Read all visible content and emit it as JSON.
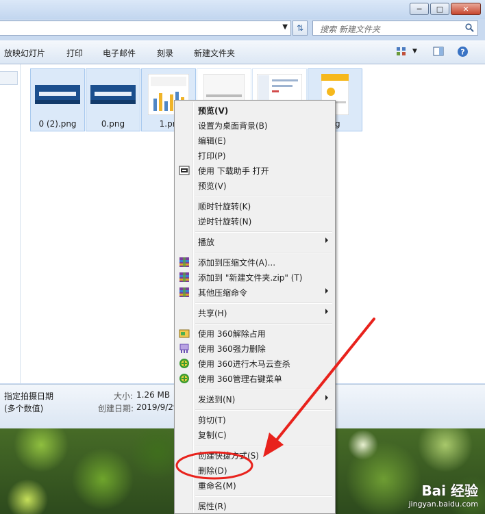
{
  "search": {
    "placeholder": "搜索 新建文件夹"
  },
  "toolbar": {
    "items": [
      "放映幻灯片",
      "打印",
      "电子邮件",
      "刻录",
      "新建文件夹"
    ]
  },
  "files": [
    {
      "name": "0 (2).png"
    },
    {
      "name": "0.png"
    },
    {
      "name": "1.pn"
    },
    {
      "name": ""
    },
    {
      "name": ""
    },
    {
      "name": "ng"
    }
  ],
  "details": {
    "left1": "指定拍摄日期",
    "left2": "(多个数值)",
    "size_label": "大小:",
    "size_value": "1.26 MB",
    "created_label": "创建日期:",
    "created_value": "2019/9/29"
  },
  "context_menu": {
    "items": [
      {
        "label": "预览(V)",
        "bold": true
      },
      {
        "label": "设置为桌面背景(B)"
      },
      {
        "label": "编辑(E)"
      },
      {
        "label": "打印(P)"
      },
      {
        "label": "使用 下载助手 打开",
        "icon": "download-helper-icon"
      },
      {
        "label": "预览(V)"
      },
      {
        "label": "顺时针旋转(K)"
      },
      {
        "label": "逆时针旋转(N)"
      },
      {
        "label": "播放",
        "submenu": true
      },
      {
        "label": "添加到压缩文件(A)...",
        "icon": "winrar-icon"
      },
      {
        "label": "添加到 \"新建文件夹.zip\" (T)",
        "icon": "winrar-icon"
      },
      {
        "label": "其他压缩命令",
        "icon": "winrar-icon",
        "submenu": true
      },
      {
        "label": "共享(H)",
        "submenu": true
      },
      {
        "label": "使用 360解除占用",
        "icon": "unlock-360-icon"
      },
      {
        "label": "使用 360强力删除",
        "icon": "shred-360-icon"
      },
      {
        "label": "使用 360进行木马云查杀",
        "icon": "shield-360-icon"
      },
      {
        "label": "使用 360管理右键菜单",
        "icon": "shield-360-icon"
      },
      {
        "label": "发送到(N)",
        "submenu": true
      },
      {
        "label": "剪切(T)"
      },
      {
        "label": "复制(C)"
      },
      {
        "label": "创建快捷方式(S)"
      },
      {
        "label": "删除(D)"
      },
      {
        "label": "重命名(M)"
      },
      {
        "label": "属性(R)"
      }
    ]
  },
  "watermark": {
    "logo": "Bai 经验",
    "url": "jingyan.baidu.com"
  },
  "colors": {
    "annotation_red": "#e8221c",
    "selection_blue": "#dbe9f9",
    "menu_bg": "#f0f0f0"
  }
}
